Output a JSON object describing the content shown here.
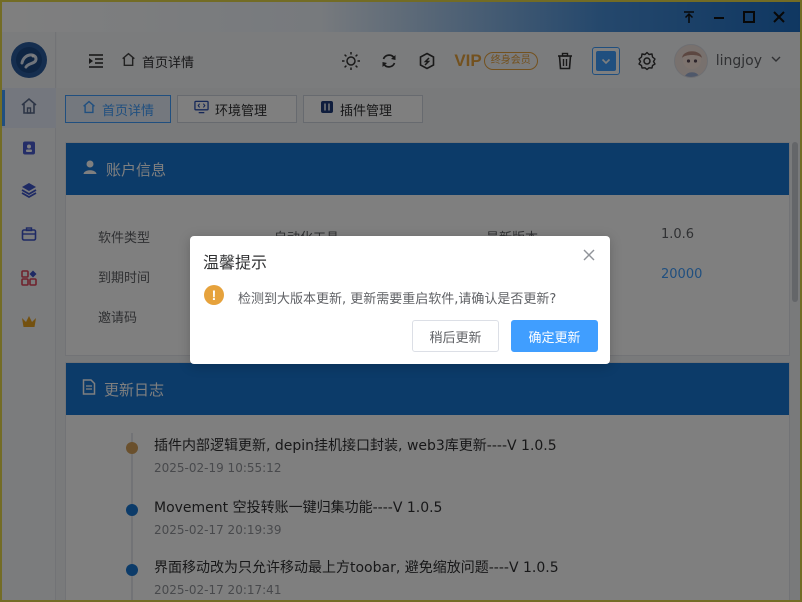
{
  "window": {
    "controls": [
      "pin-icon",
      "minimize-icon",
      "maximize-icon",
      "close-icon"
    ]
  },
  "sidebar": {
    "items": [
      {
        "icon": "home-icon",
        "active": true
      },
      {
        "icon": "contact-card-icon"
      },
      {
        "icon": "layers-icon"
      },
      {
        "icon": "briefcase-icon"
      },
      {
        "icon": "apps-grid-icon"
      },
      {
        "icon": "crown-icon"
      }
    ]
  },
  "header": {
    "breadcrumb": "首页详情",
    "vip_label": "VIP",
    "vip_badge": "终身会员",
    "username": "lingjoy"
  },
  "tabs": [
    {
      "label": "首页详情",
      "active": true
    },
    {
      "label": "环境管理"
    },
    {
      "label": "插件管理"
    }
  ],
  "account_card": {
    "title": "账户信息",
    "rows": [
      {
        "label": "软件类型",
        "value": "自动化工具",
        "label2": "最新版本",
        "value2": "1.0.6"
      },
      {
        "label": "到期时间",
        "value": "",
        "label2": "",
        "value2": "20000"
      },
      {
        "label": "邀请码",
        "value": "",
        "label2": "",
        "value2": ""
      }
    ]
  },
  "log_card": {
    "title": "更新日志",
    "entries": [
      {
        "title": "插件内部逻辑更新, depin挂机接口封装, web3库更新----V 1.0.5",
        "time": "2025-02-19 10:55:12",
        "color": "#d4a15a"
      },
      {
        "title": "Movement 空投转账一键归集功能----V 1.0.5",
        "time": "2025-02-17 20:19:39",
        "color": "#1976d2"
      },
      {
        "title": "界面移动改为只允许移动最上方toobar, 避免缩放问题----V 1.0.5",
        "time": "2025-02-17 20:17:41",
        "color": "#1976d2"
      }
    ]
  },
  "dialog": {
    "title": "温馨提示",
    "message": "检测到大版本更新, 更新需要重启软件,请确认是否更新?",
    "cancel_label": "稍后更新",
    "confirm_label": "确定更新"
  },
  "colors": {
    "primary": "#409eff",
    "header_blue": "#1976d2",
    "warning": "#e6a23c"
  }
}
